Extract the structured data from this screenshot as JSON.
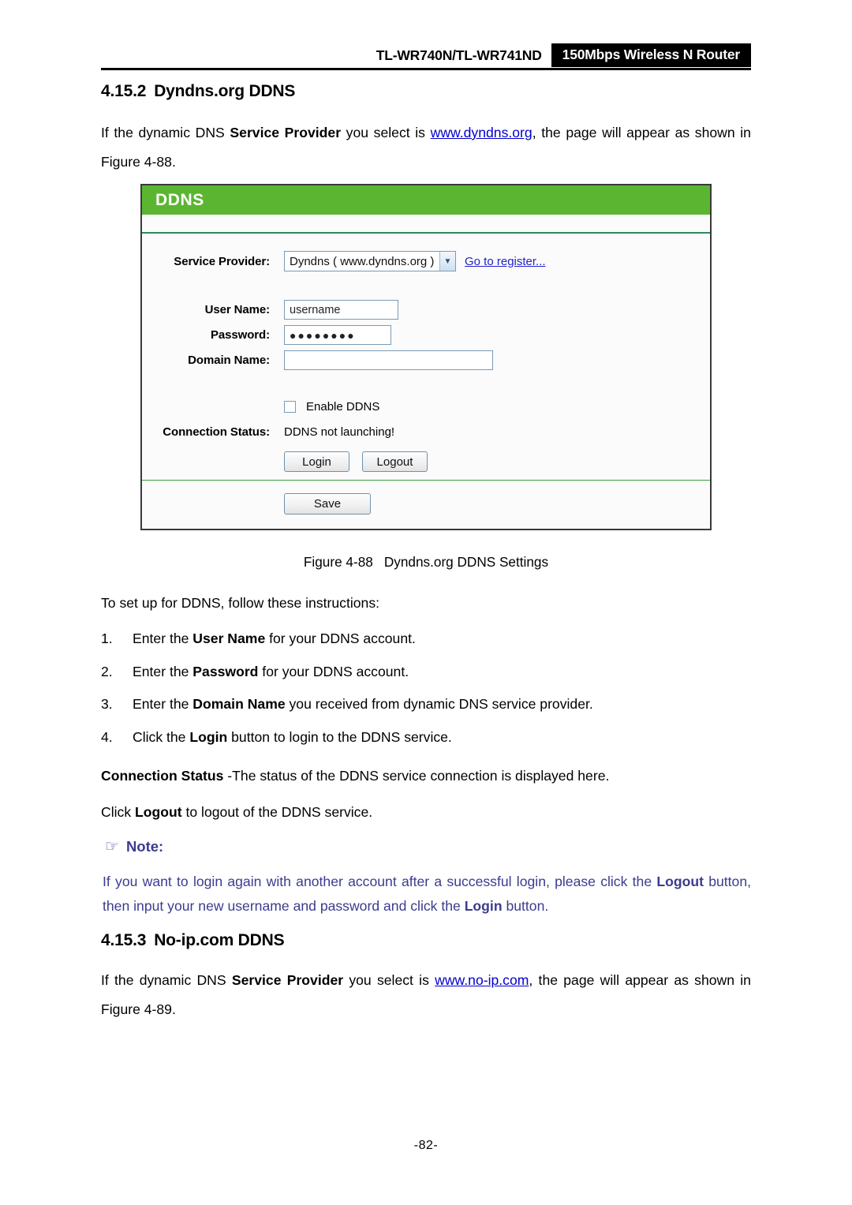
{
  "header": {
    "model": "TL-WR740N/TL-WR741ND",
    "banner": "150Mbps Wireless N Router"
  },
  "sections": {
    "s1": {
      "number": "4.15.2",
      "title": "Dyndns.org DDNS",
      "intro_pre": "If the dynamic DNS ",
      "intro_bold": "Service Provider",
      "intro_mid": " you select is ",
      "intro_link": "www.dyndns.org",
      "intro_post": ", the page will appear as shown in Figure 4-88."
    },
    "s2": {
      "number": "4.15.3",
      "title": "No-ip.com DDNS",
      "intro_pre": "If the dynamic DNS ",
      "intro_bold": "Service Provider",
      "intro_mid": " you select is ",
      "intro_link": "www.no-ip.com",
      "intro_post": ", the page will appear as shown in Figure 4-89."
    }
  },
  "figure": {
    "caption_label": "Figure 4-88",
    "caption_text": "Dyndns.org DDNS Settings",
    "panel_title": "DDNS",
    "accent_green": "#5cb531",
    "divider_green": "#2e8b57",
    "labels": {
      "service_provider": "Service Provider:",
      "user_name": "User Name:",
      "password": "Password:",
      "domain_name": "Domain Name:",
      "connection_status": "Connection Status:"
    },
    "service_provider_selected": "Dyndns ( www.dyndns.org )",
    "register_link": "Go to register...",
    "user_name_value": "username",
    "password_value": "●●●●●●●●",
    "domain_name_value": "",
    "enable_ddns_label": "Enable DDNS",
    "enable_ddns_checked": false,
    "connection_status_value": "DDNS not launching!",
    "login_label": "Login",
    "logout_label": "Logout",
    "save_label": "Save"
  },
  "instructions": {
    "lead": "To set up for DDNS, follow these instructions:",
    "items": [
      {
        "mark": "1.",
        "pre": "Enter the ",
        "bold": "User Name",
        "post": " for your DDNS account."
      },
      {
        "mark": "2.",
        "pre": "Enter the ",
        "bold": "Password",
        "post": " for your DDNS account."
      },
      {
        "mark": "3.",
        "pre": "Enter the ",
        "bold": "Domain Name",
        "post": " you received from dynamic DNS service provider."
      },
      {
        "mark": "4.",
        "pre": "Click the ",
        "bold": "Login",
        "post": " button to login to the DDNS service."
      }
    ]
  },
  "status_paragraph": {
    "bold": "Connection Status",
    "rest": " -The status of the DDNS service connection is displayed here."
  },
  "logout_paragraph": {
    "pre": "Click ",
    "bold": "Logout",
    "post": " to logout of the DDNS service."
  },
  "note": {
    "icon": "hand-pointing-right-icon",
    "glyph": "☞",
    "title": "Note:",
    "color": "#3b3b8f",
    "pre": " If you want to login again with another account after a successful login, please click the ",
    "bold1": "Logout",
    "mid": " button, then input your new username and password and click the ",
    "bold2": "Login",
    "post": " button."
  },
  "folio": "-82-"
}
